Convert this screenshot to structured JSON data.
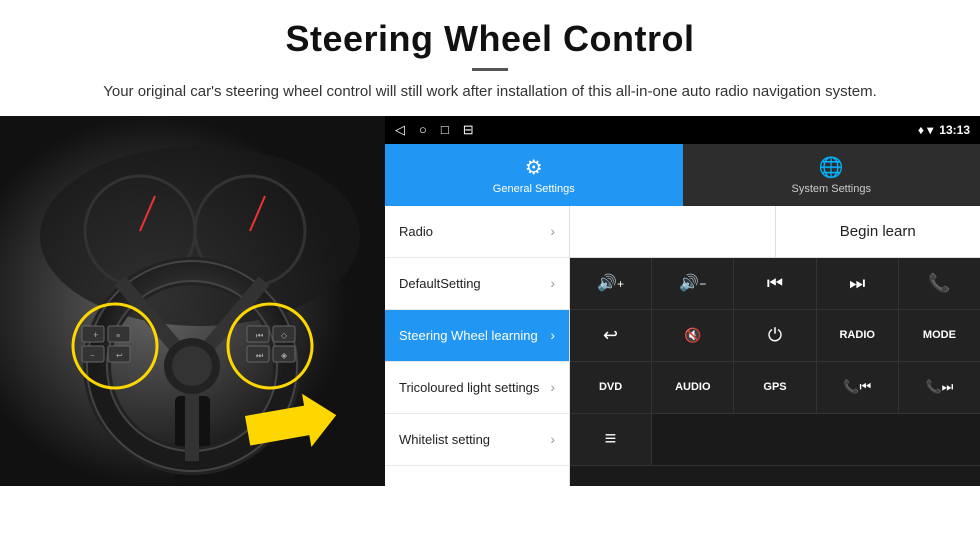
{
  "header": {
    "title": "Steering Wheel Control",
    "subtitle": "Your original car's steering wheel control will still work after installation of this all-in-one auto radio navigation system."
  },
  "status_bar": {
    "nav_back": "◁",
    "nav_home": "○",
    "nav_recents": "□",
    "nav_extra": "⊟",
    "location_icon": "♦",
    "signal_icon": "▾",
    "time": "13:13"
  },
  "tabs": [
    {
      "id": "general",
      "label": "General Settings",
      "icon": "⚙",
      "active": true
    },
    {
      "id": "system",
      "label": "System Settings",
      "icon": "🌐",
      "active": false
    }
  ],
  "menu_items": [
    {
      "id": "radio",
      "label": "Radio",
      "active": false
    },
    {
      "id": "default-setting",
      "label": "DefaultSetting",
      "active": false
    },
    {
      "id": "steering-wheel",
      "label": "Steering Wheel learning",
      "active": true
    },
    {
      "id": "tricoloured",
      "label": "Tricoloured light settings",
      "active": false
    },
    {
      "id": "whitelist",
      "label": "Whitelist setting",
      "active": false
    }
  ],
  "controls": {
    "begin_learn_label": "Begin learn",
    "row1": [
      "🔊+",
      "🔊−",
      "⏮",
      "⏭",
      "📞"
    ],
    "row2": [
      "↩",
      "🔊×",
      "⏻",
      "RADIO",
      "MODE"
    ],
    "row3": [
      "DVD",
      "AUDIO",
      "GPS",
      "📞⏮",
      "📞⏭"
    ],
    "row4": [
      "≡"
    ]
  }
}
